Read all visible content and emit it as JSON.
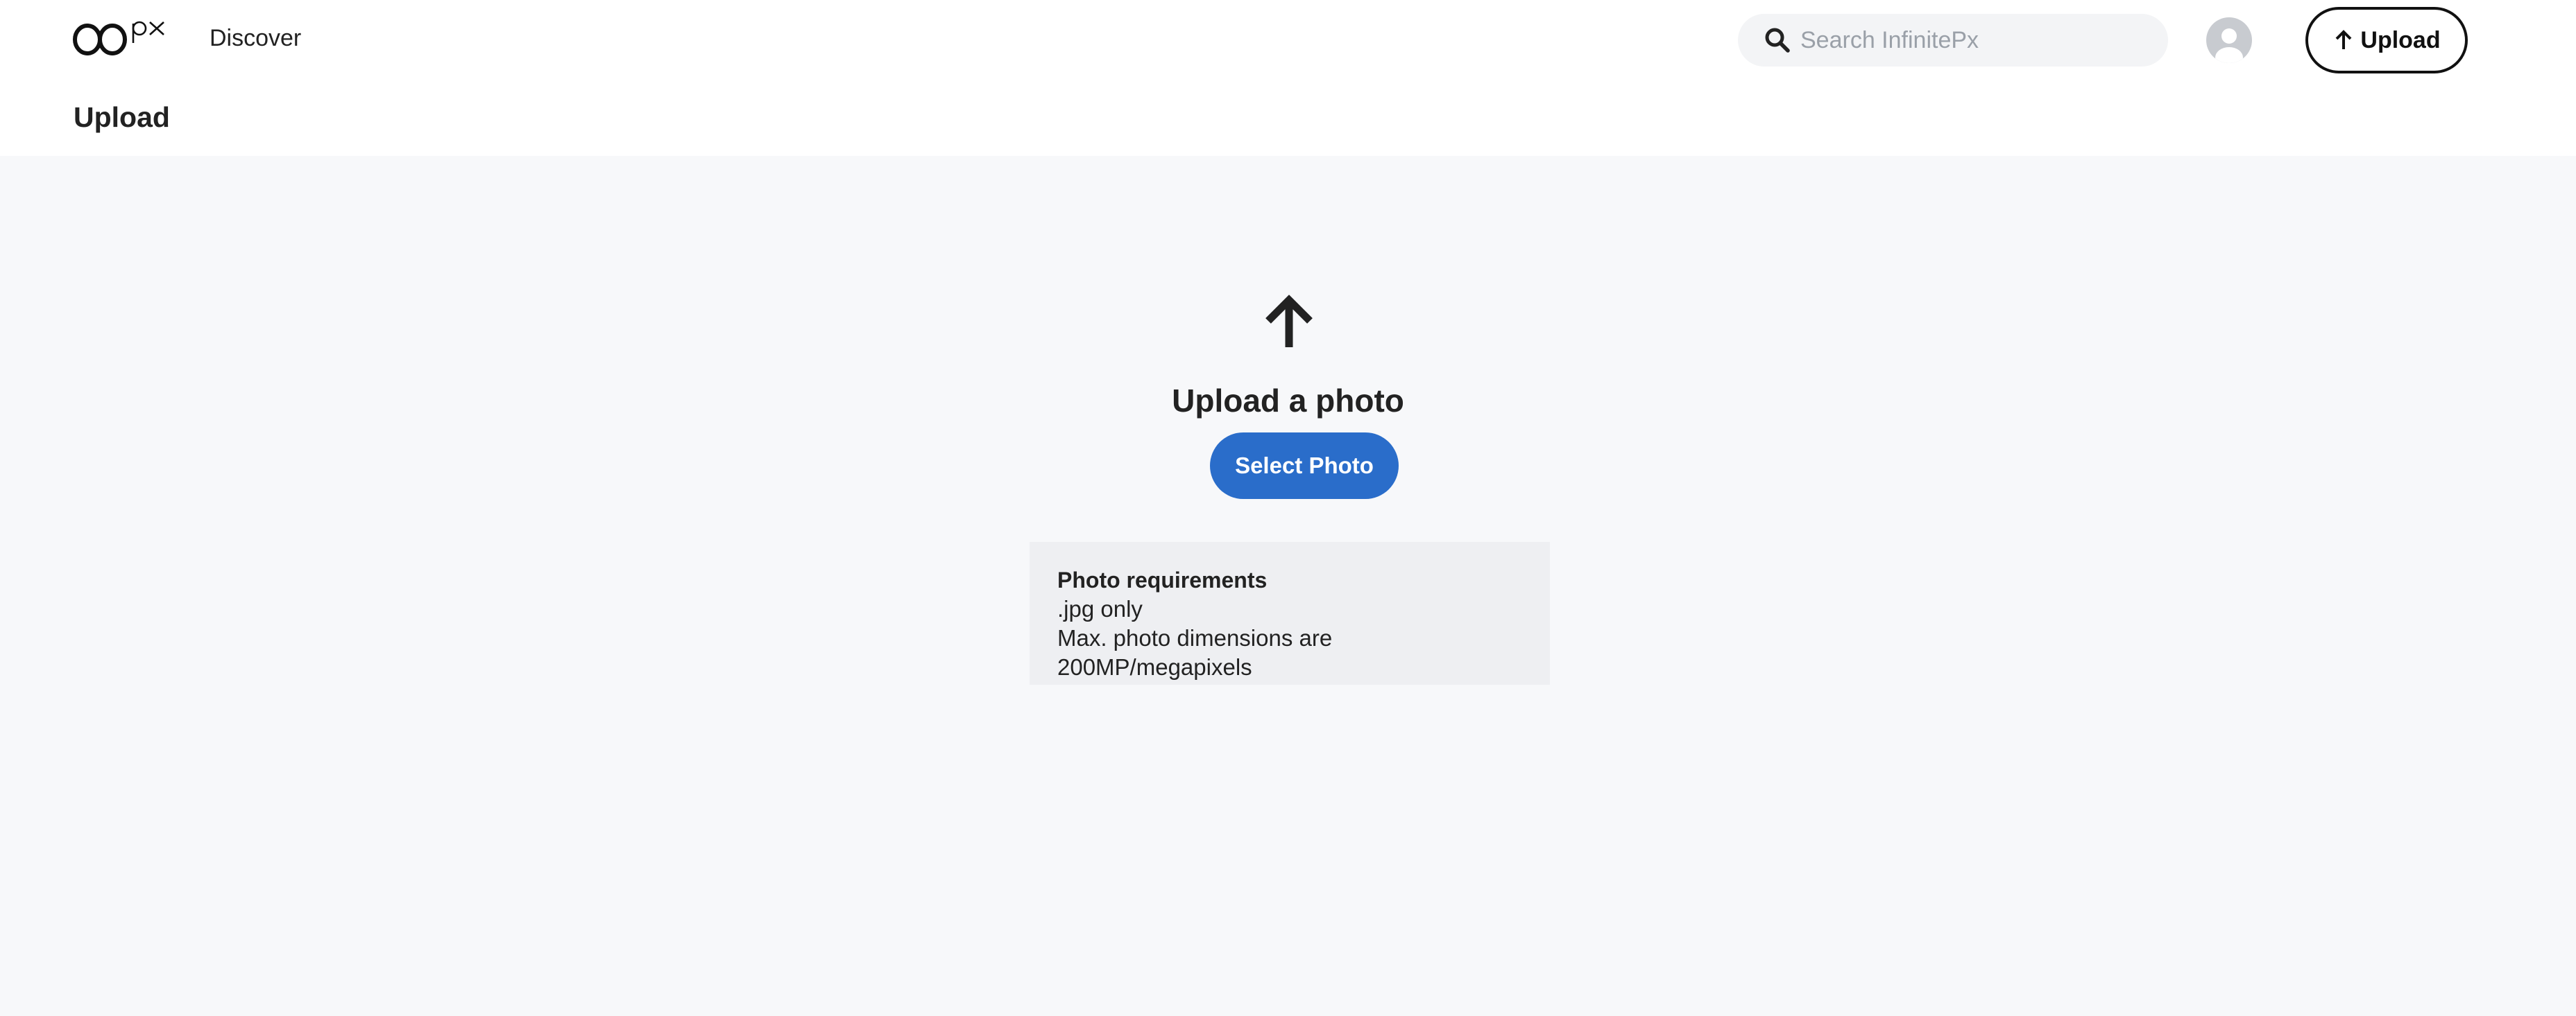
{
  "header": {
    "logo_text": "∞px",
    "nav": {
      "discover_label": "Discover"
    },
    "search": {
      "placeholder": "Search InfinitePx",
      "value": "",
      "icon": "search-icon"
    },
    "avatar_icon": "user-avatar-icon",
    "upload_button": {
      "label": "Upload",
      "icon": "arrow-up-icon"
    }
  },
  "page": {
    "title": "Upload"
  },
  "main": {
    "icon": "arrow-up-icon",
    "heading": "Upload a photo",
    "select_button_label": "Select Photo",
    "requirements": {
      "title": "Photo requirements",
      "lines": [
        ".jpg only",
        "Max. photo dimensions are 200MP/megapixels"
      ]
    }
  },
  "colors": {
    "primary_blue": "#2a6dca",
    "main_background": "#f7f8fa",
    "requirements_background": "#eeeff2",
    "text": "#222222"
  }
}
